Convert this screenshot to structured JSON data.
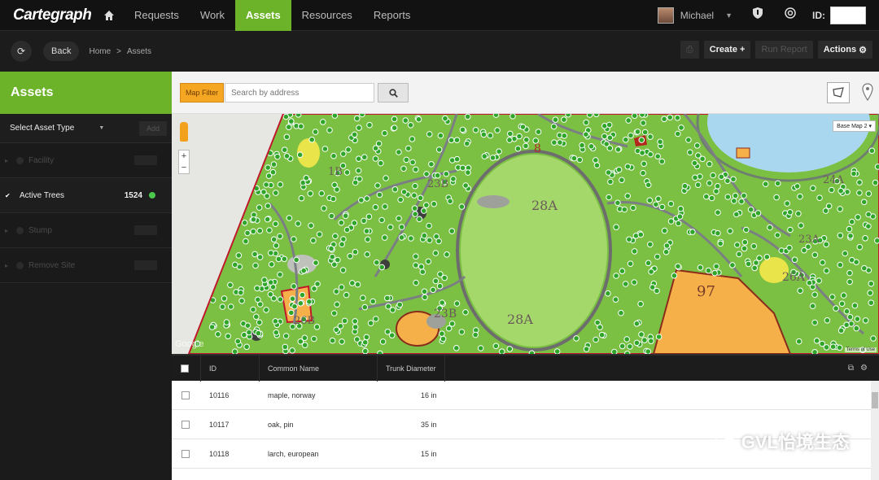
{
  "app": {
    "logo": "Cartegraph"
  },
  "nav": {
    "items": [
      {
        "label": "Requests"
      },
      {
        "label": "Work"
      },
      {
        "label": "Assets"
      },
      {
        "label": "Resources"
      },
      {
        "label": "Reports"
      }
    ],
    "user": "Michael",
    "id_label": "ID:"
  },
  "toolbar": {
    "back": "Back",
    "breadcrumb": [
      "Home",
      ">",
      "Assets"
    ],
    "create": "Create",
    "run_report": "Run Report",
    "actions": "Actions"
  },
  "sidebar": {
    "title": "Assets",
    "select": "Select Asset Type",
    "add": "Add",
    "layers": [
      {
        "name": "Facility"
      },
      {
        "name": "Active Trees",
        "count": "1524"
      },
      {
        "name": "Stump"
      },
      {
        "name": "Remove Site"
      }
    ]
  },
  "map": {
    "filter": "Map Filter",
    "search_placeholder": "Search by address",
    "basemap": "Base Map 2",
    "zoom_in": "+",
    "zoom_out": "−",
    "terms": "Terms of Use",
    "google": "Google",
    "labels": [
      "28A",
      "28A",
      "97",
      "26A",
      "23B",
      "8",
      "23B",
      "26B",
      "24A",
      "23A",
      "1B"
    ]
  },
  "table": {
    "columns": [
      "ID",
      "Common Name",
      "Trunk Diameter"
    ],
    "rows": [
      {
        "id": "10116",
        "name": "maple, norway",
        "diameter": "16 in"
      },
      {
        "id": "10117",
        "name": "oak, pin",
        "diameter": "35 in"
      },
      {
        "id": "10118",
        "name": "larch, european",
        "diameter": "15 in"
      }
    ]
  },
  "watermark": "GVL怡境生态",
  "colors": {
    "accent": "#6cb32a",
    "filter": "#f5a623",
    "boundary": "#c0172b",
    "tree": "#1f8f1a"
  }
}
